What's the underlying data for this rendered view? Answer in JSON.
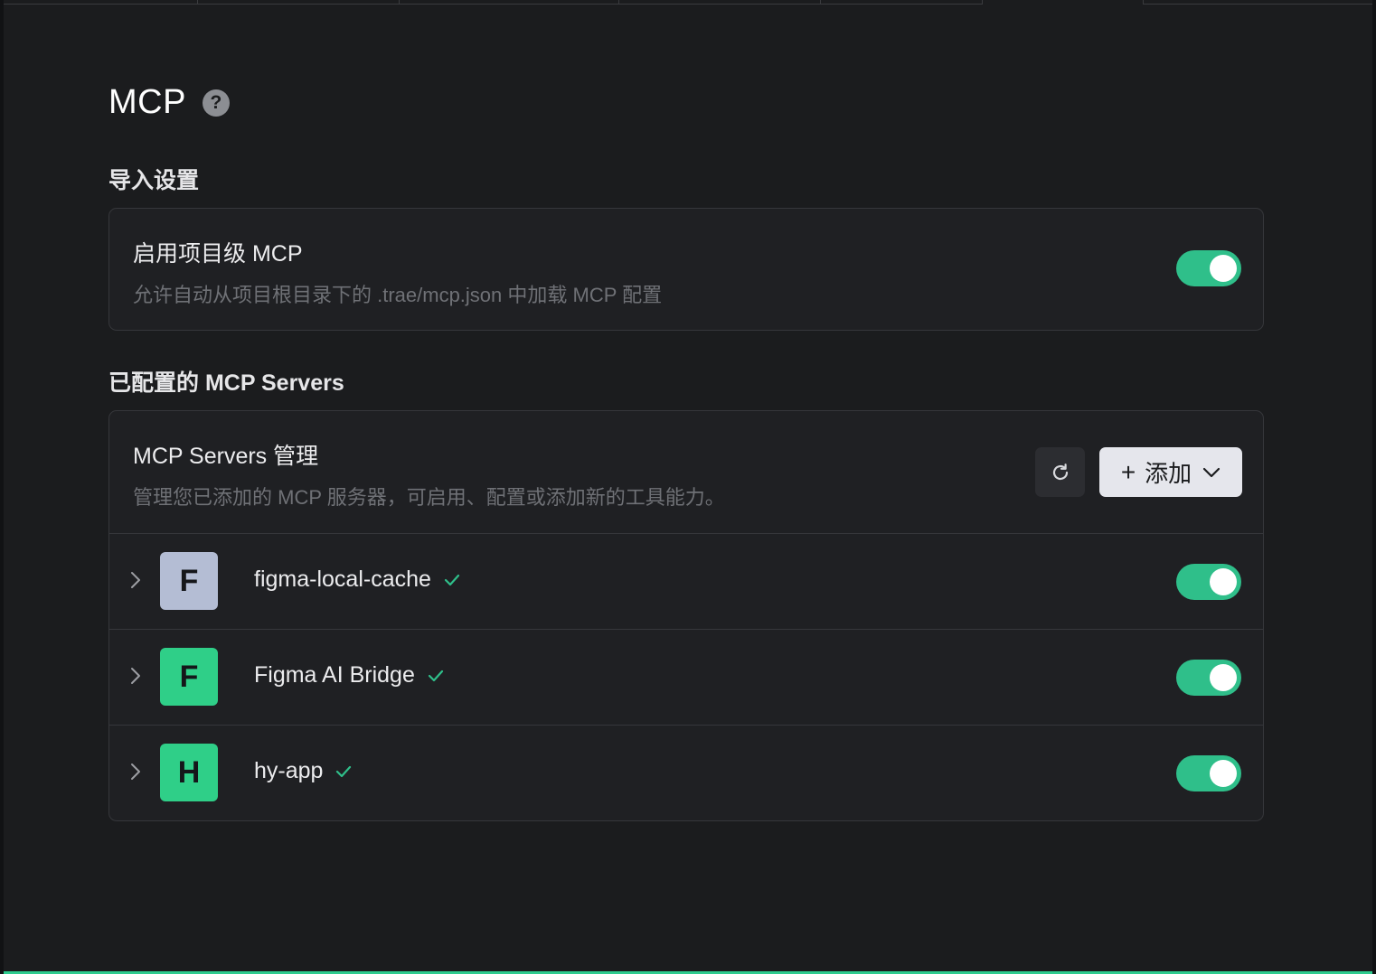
{
  "page": {
    "title": "MCP"
  },
  "import_section": {
    "heading": "导入设置",
    "project_mcp": {
      "title": "启用项目级 MCP",
      "description": "允许自动从项目根目录下的 .trae/mcp.json 中加载 MCP 配置",
      "enabled": true
    }
  },
  "servers_section": {
    "heading": "已配置的 MCP Servers",
    "management": {
      "title": "MCP Servers 管理",
      "description": "管理您已添加的 MCP 服务器，可启用、配置或添加新的工具能力。",
      "refresh_icon": "refresh-icon",
      "add_label": "添加",
      "add_plus": "+"
    },
    "servers": [
      {
        "initial": "F",
        "name": "figma-local-cache",
        "status": "check",
        "enabled": true,
        "avatar_color": "#b4bdd4"
      },
      {
        "initial": "F",
        "name": "Figma AI Bridge",
        "status": "check",
        "enabled": true,
        "avatar_color": "#2fcf88"
      },
      {
        "initial": "H",
        "name": "hy-app",
        "status": "check",
        "enabled": true,
        "avatar_color": "#2fcf88"
      }
    ]
  },
  "colors": {
    "accent": "#2fbf8a",
    "background": "#1b1c1e",
    "card": "#1f2023",
    "border": "#36373b",
    "muted_text": "#6f7176"
  }
}
